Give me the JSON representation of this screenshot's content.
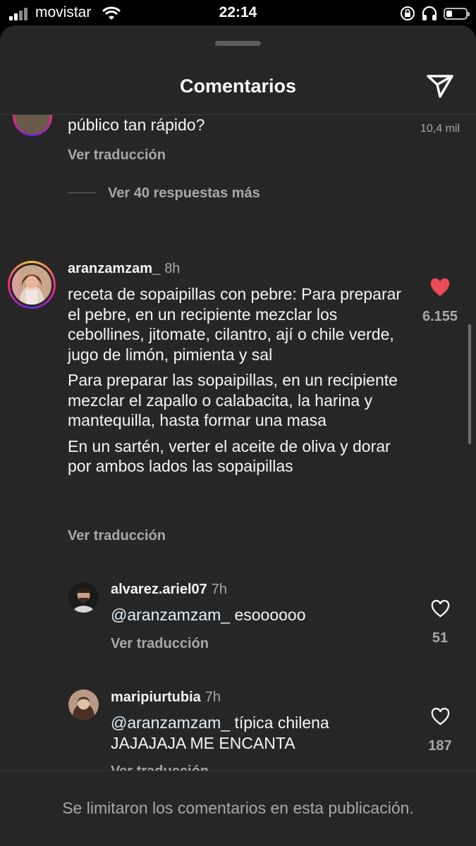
{
  "status_bar": {
    "carrier": "movistar",
    "time": "22:14",
    "icons": [
      "signal-icon",
      "wifi-icon",
      "orientation-lock-icon",
      "headphones-icon",
      "battery-icon"
    ]
  },
  "header": {
    "title": "Comentarios",
    "share_icon": "paper-plane-icon"
  },
  "partial_comment": {
    "text": "público tan rápido?",
    "likes": "10,4 mil",
    "translate": "Ver traducción",
    "view_replies": "Ver 40 respuestas más"
  },
  "main_comment": {
    "username": "aranzamzam_",
    "time": "8h",
    "paragraphs": [
      "receta de sopaipillas con pebre: Para preparar el pebre, en un recipiente mezclar los cebollines, jitomate, cilantro, ají o chile verde, jugo de limón, pimienta y sal",
      "Para preparar las sopaipillas, en un recipiente mezclar el zapallo o calabacita, la harina y mantequilla, hasta formar una masa",
      "En un sartén, verter el aceite de oliva y dorar por ambos lados las sopaipillas"
    ],
    "likes": "6.155",
    "liked": true,
    "like_color": "#ed4956",
    "translate": "Ver traducción"
  },
  "replies": [
    {
      "username": "alvarez.ariel07",
      "time": "7h",
      "mention": "@aranzamzam_",
      "text": " esoooooo",
      "likes": "51",
      "translate": "Ver traducción"
    },
    {
      "username": "maripiurtubia",
      "time": "7h",
      "mention": "@aranzamzam_",
      "text": " típica chilena JAJAJAJA ME ENCANTA",
      "likes": "187",
      "translate": "Ver traducción"
    }
  ],
  "footer": {
    "text": "Se limitaron los comentarios en esta publicación."
  }
}
